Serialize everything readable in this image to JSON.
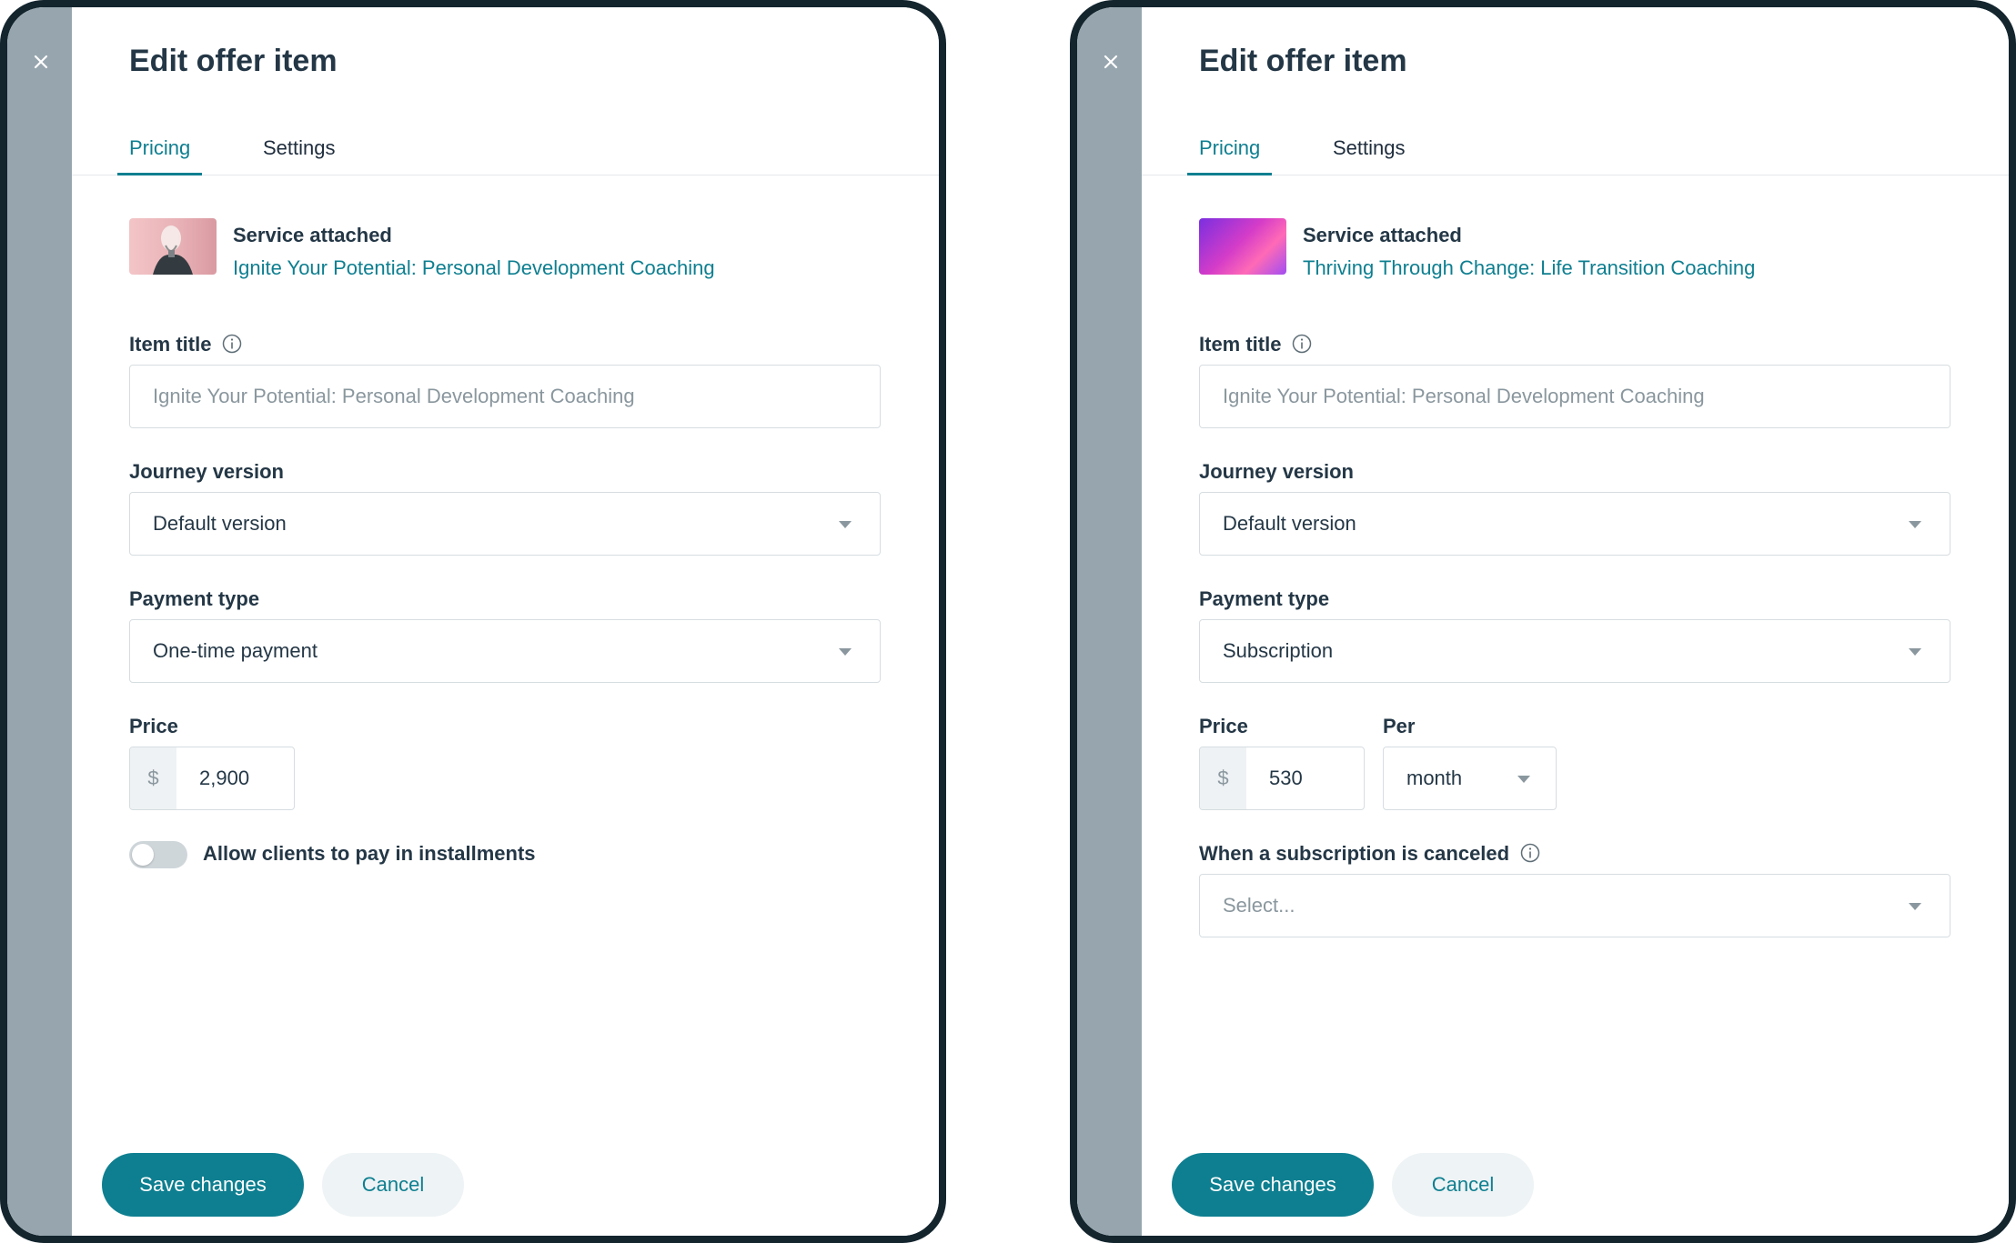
{
  "screens": [
    {
      "title": "Edit offer item",
      "tabs": {
        "pricing": "Pricing",
        "settings": "Settings"
      },
      "service": {
        "label": "Service attached",
        "name": "Ignite Your Potential: Personal Development Coaching"
      },
      "item_title": {
        "label": "Item title",
        "placeholder": "Ignite Your Potential: Personal Development Coaching"
      },
      "journey_version": {
        "label": "Journey version",
        "value": "Default version"
      },
      "payment_type": {
        "label": "Payment type",
        "value": "One-time payment"
      },
      "price": {
        "label": "Price",
        "currency": "$",
        "value": "2,900"
      },
      "installments": {
        "label": "Allow clients to pay in installments",
        "enabled": false
      },
      "buttons": {
        "save": "Save changes",
        "cancel": "Cancel"
      }
    },
    {
      "title": "Edit offer item",
      "tabs": {
        "pricing": "Pricing",
        "settings": "Settings"
      },
      "service": {
        "label": "Service attached",
        "name": "Thriving Through Change: Life Transition Coaching"
      },
      "item_title": {
        "label": "Item title",
        "placeholder": "Ignite Your Potential: Personal Development Coaching"
      },
      "journey_version": {
        "label": "Journey version",
        "value": "Default version"
      },
      "payment_type": {
        "label": "Payment type",
        "value": "Subscription"
      },
      "price": {
        "label": "Price",
        "currency": "$",
        "value": "530"
      },
      "per": {
        "label": "Per",
        "value": "month"
      },
      "cancel_policy": {
        "label": "When a subscription is canceled",
        "placeholder": "Select..."
      },
      "buttons": {
        "save": "Save changes",
        "cancel": "Cancel"
      }
    }
  ],
  "colors": {
    "accent": "#0e7f90",
    "frame": "#14252e",
    "side_strip": "#97a6ae"
  },
  "icons": {
    "close": "close-icon",
    "info": "info-icon",
    "dropdown": "chevron-down-icon"
  }
}
